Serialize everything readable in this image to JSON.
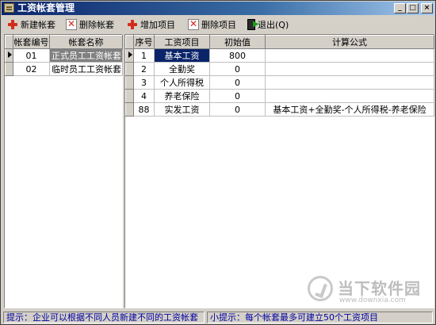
{
  "window": {
    "title": "工资帐套管理"
  },
  "titlebar_buttons": {
    "minimize": "_",
    "maximize": "□",
    "close": "×"
  },
  "toolbar": {
    "new_ledger": "新建帐套",
    "delete_ledger": "删除帐套",
    "add_item": "增加项目",
    "delete_item": "删除项目",
    "exit": "退出(Q)"
  },
  "ledgers": {
    "columns": [
      "帐套编号",
      "帐套名称"
    ],
    "rows": [
      {
        "id": "01",
        "name": "正式员工工资帐套",
        "selected": true
      },
      {
        "id": "02",
        "name": "临时员工工资帐套",
        "selected": false
      }
    ]
  },
  "items": {
    "columns": [
      "序号",
      "工资项目",
      "初始值",
      "计算公式"
    ],
    "rows": [
      {
        "no": "1",
        "name": "基本工资",
        "init": "800",
        "formula": "",
        "current": true
      },
      {
        "no": "2",
        "name": "全勤奖",
        "init": "0",
        "formula": ""
      },
      {
        "no": "3",
        "name": "个人所得税",
        "init": "0",
        "formula": ""
      },
      {
        "no": "4",
        "name": "养老保险",
        "init": "0",
        "formula": ""
      },
      {
        "no": "88",
        "name": "实发工资",
        "init": "0",
        "formula": "基本工资+全勤奖-个人所得税-养老保险"
      }
    ]
  },
  "status": {
    "hint": "提示：企业可以根据不同人员新建不同的工资帐套",
    "tip": "小提示：每个帐套最多可建立50个工资项目"
  },
  "watermark": {
    "name": "当下软件园",
    "url": "www.downxia.com"
  }
}
